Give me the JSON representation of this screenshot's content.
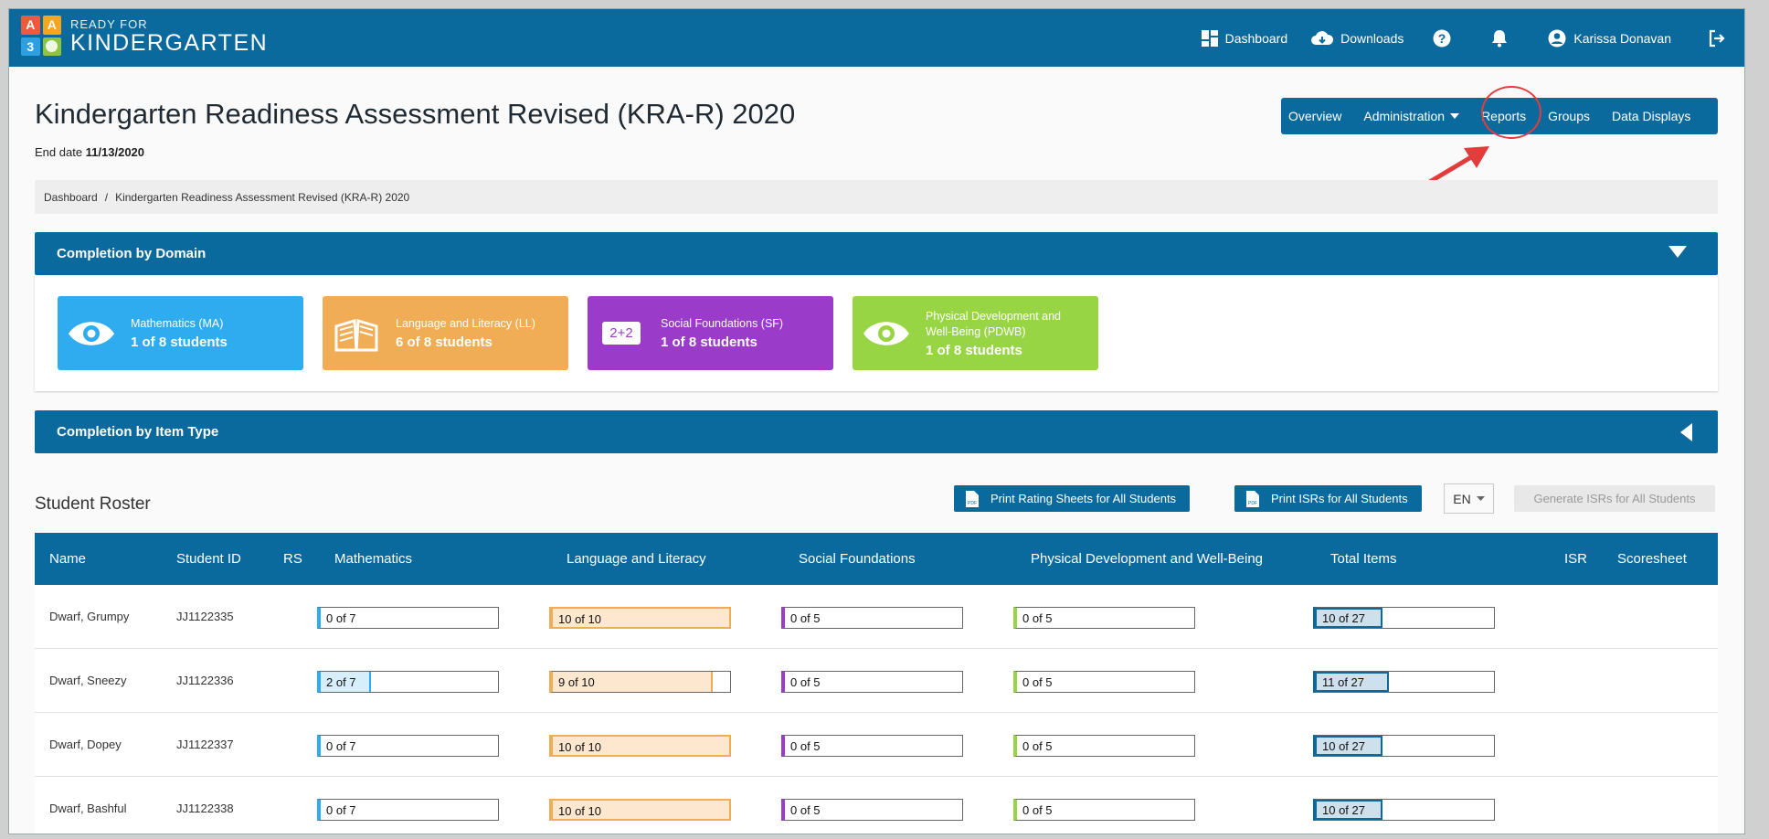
{
  "logo": {
    "blocks": [
      "A",
      "A",
      "3",
      ""
    ],
    "block_colors": [
      "#f05a3a",
      "#f7a51e",
      "#2f9fe0",
      "#8cc63f"
    ],
    "top_text": "READY FOR",
    "main_text": "KINDERGARTEN"
  },
  "topnav": {
    "dashboard": "Dashboard",
    "downloads": "Downloads",
    "user": "Karissa Donavan",
    "icons": [
      "dashboard-grid-icon",
      "cloud-download-icon",
      "help-icon",
      "bell-icon",
      "user-icon",
      "logout-icon"
    ]
  },
  "page": {
    "title": "Kindergarten Readiness Assessment Revised (KRA-R) 2020",
    "end_date_label": "End date",
    "end_date": "11/13/2020"
  },
  "subnav": {
    "overview": "Overview",
    "administration": "Administration",
    "reports": "Reports",
    "groups": "Groups",
    "data_displays": "Data Displays"
  },
  "breadcrumb": {
    "home": "Dashboard",
    "sep": "/",
    "current": "Kindergarten Readiness Assessment Revised (KRA-R) 2020"
  },
  "completion_by_domain": {
    "title": "Completion by Domain",
    "cards": [
      {
        "name": "Mathematics (MA)",
        "count": "1 of 8 students",
        "color": "#2eacef",
        "icon": "eye-icon"
      },
      {
        "name": "Language and Literacy (LL)",
        "count": "6 of 8 students",
        "color": "#f0ad55",
        "icon": "book-icon"
      },
      {
        "name": "Social Foundations (SF)",
        "count": "1 of 8 students",
        "color": "#9b3bc9",
        "icon": "two-plus-two-icon",
        "icon_text": "2+2"
      },
      {
        "name": "Physical Development and Well-Being (PDWB)",
        "count": "1 of 8 students",
        "color": "#98d545",
        "icon": "eye-icon"
      }
    ]
  },
  "completion_by_item_type": {
    "title": "Completion by Item Type"
  },
  "roster": {
    "title": "Student Roster",
    "print_rating": "Print Rating Sheets for All Students",
    "print_isrs": "Print ISRs for All Students",
    "language": "EN",
    "generate_isrs": "Generate ISRs for All Students",
    "columns": [
      "Name",
      "Student ID",
      "RS",
      "Mathematics",
      "Language and Literacy",
      "Social Foundations",
      "Physical Development and Well-Being",
      "Total Items",
      "ISR",
      "Scoresheet"
    ],
    "colors": {
      "math": "#2eacef",
      "lit": "#f0ad55",
      "soc": "#9b3bc9",
      "phys": "#98d545",
      "total": "#0a6a9e"
    },
    "rows": [
      {
        "name": "Dwarf, Grumpy",
        "id": "JJ1122335",
        "math": "0 of 7",
        "math_done": 0,
        "math_total": 7,
        "lit": "10 of 10",
        "lit_done": 10,
        "lit_total": 10,
        "soc": "0 of 5",
        "soc_done": 0,
        "soc_total": 5,
        "phys": "0 of 5",
        "phys_done": 0,
        "phys_total": 5,
        "total": "10 of 27",
        "total_done": 10,
        "total_total": 27
      },
      {
        "name": "Dwarf, Sneezy",
        "id": "JJ1122336",
        "math": "2 of 7",
        "math_done": 2,
        "math_total": 7,
        "lit": "9 of 10",
        "lit_done": 9,
        "lit_total": 10,
        "soc": "0 of 5",
        "soc_done": 0,
        "soc_total": 5,
        "phys": "0 of 5",
        "phys_done": 0,
        "phys_total": 5,
        "total": "11 of 27",
        "total_done": 11,
        "total_total": 27
      },
      {
        "name": "Dwarf, Dopey",
        "id": "JJ1122337",
        "math": "0 of 7",
        "math_done": 0,
        "math_total": 7,
        "lit": "10 of 10",
        "lit_done": 10,
        "lit_total": 10,
        "soc": "0 of 5",
        "soc_done": 0,
        "soc_total": 5,
        "phys": "0 of 5",
        "phys_done": 0,
        "phys_total": 5,
        "total": "10 of 27",
        "total_done": 10,
        "total_total": 27
      },
      {
        "name": "Dwarf, Bashful",
        "id": "JJ1122338",
        "math": "0 of 7",
        "math_done": 0,
        "math_total": 7,
        "lit": "10 of 10",
        "lit_done": 10,
        "lit_total": 10,
        "soc": "0 of 5",
        "soc_done": 0,
        "soc_total": 5,
        "phys": "0 of 5",
        "phys_done": 0,
        "phys_total": 5,
        "total": "10 of 27",
        "total_done": 10,
        "total_total": 27
      }
    ]
  }
}
